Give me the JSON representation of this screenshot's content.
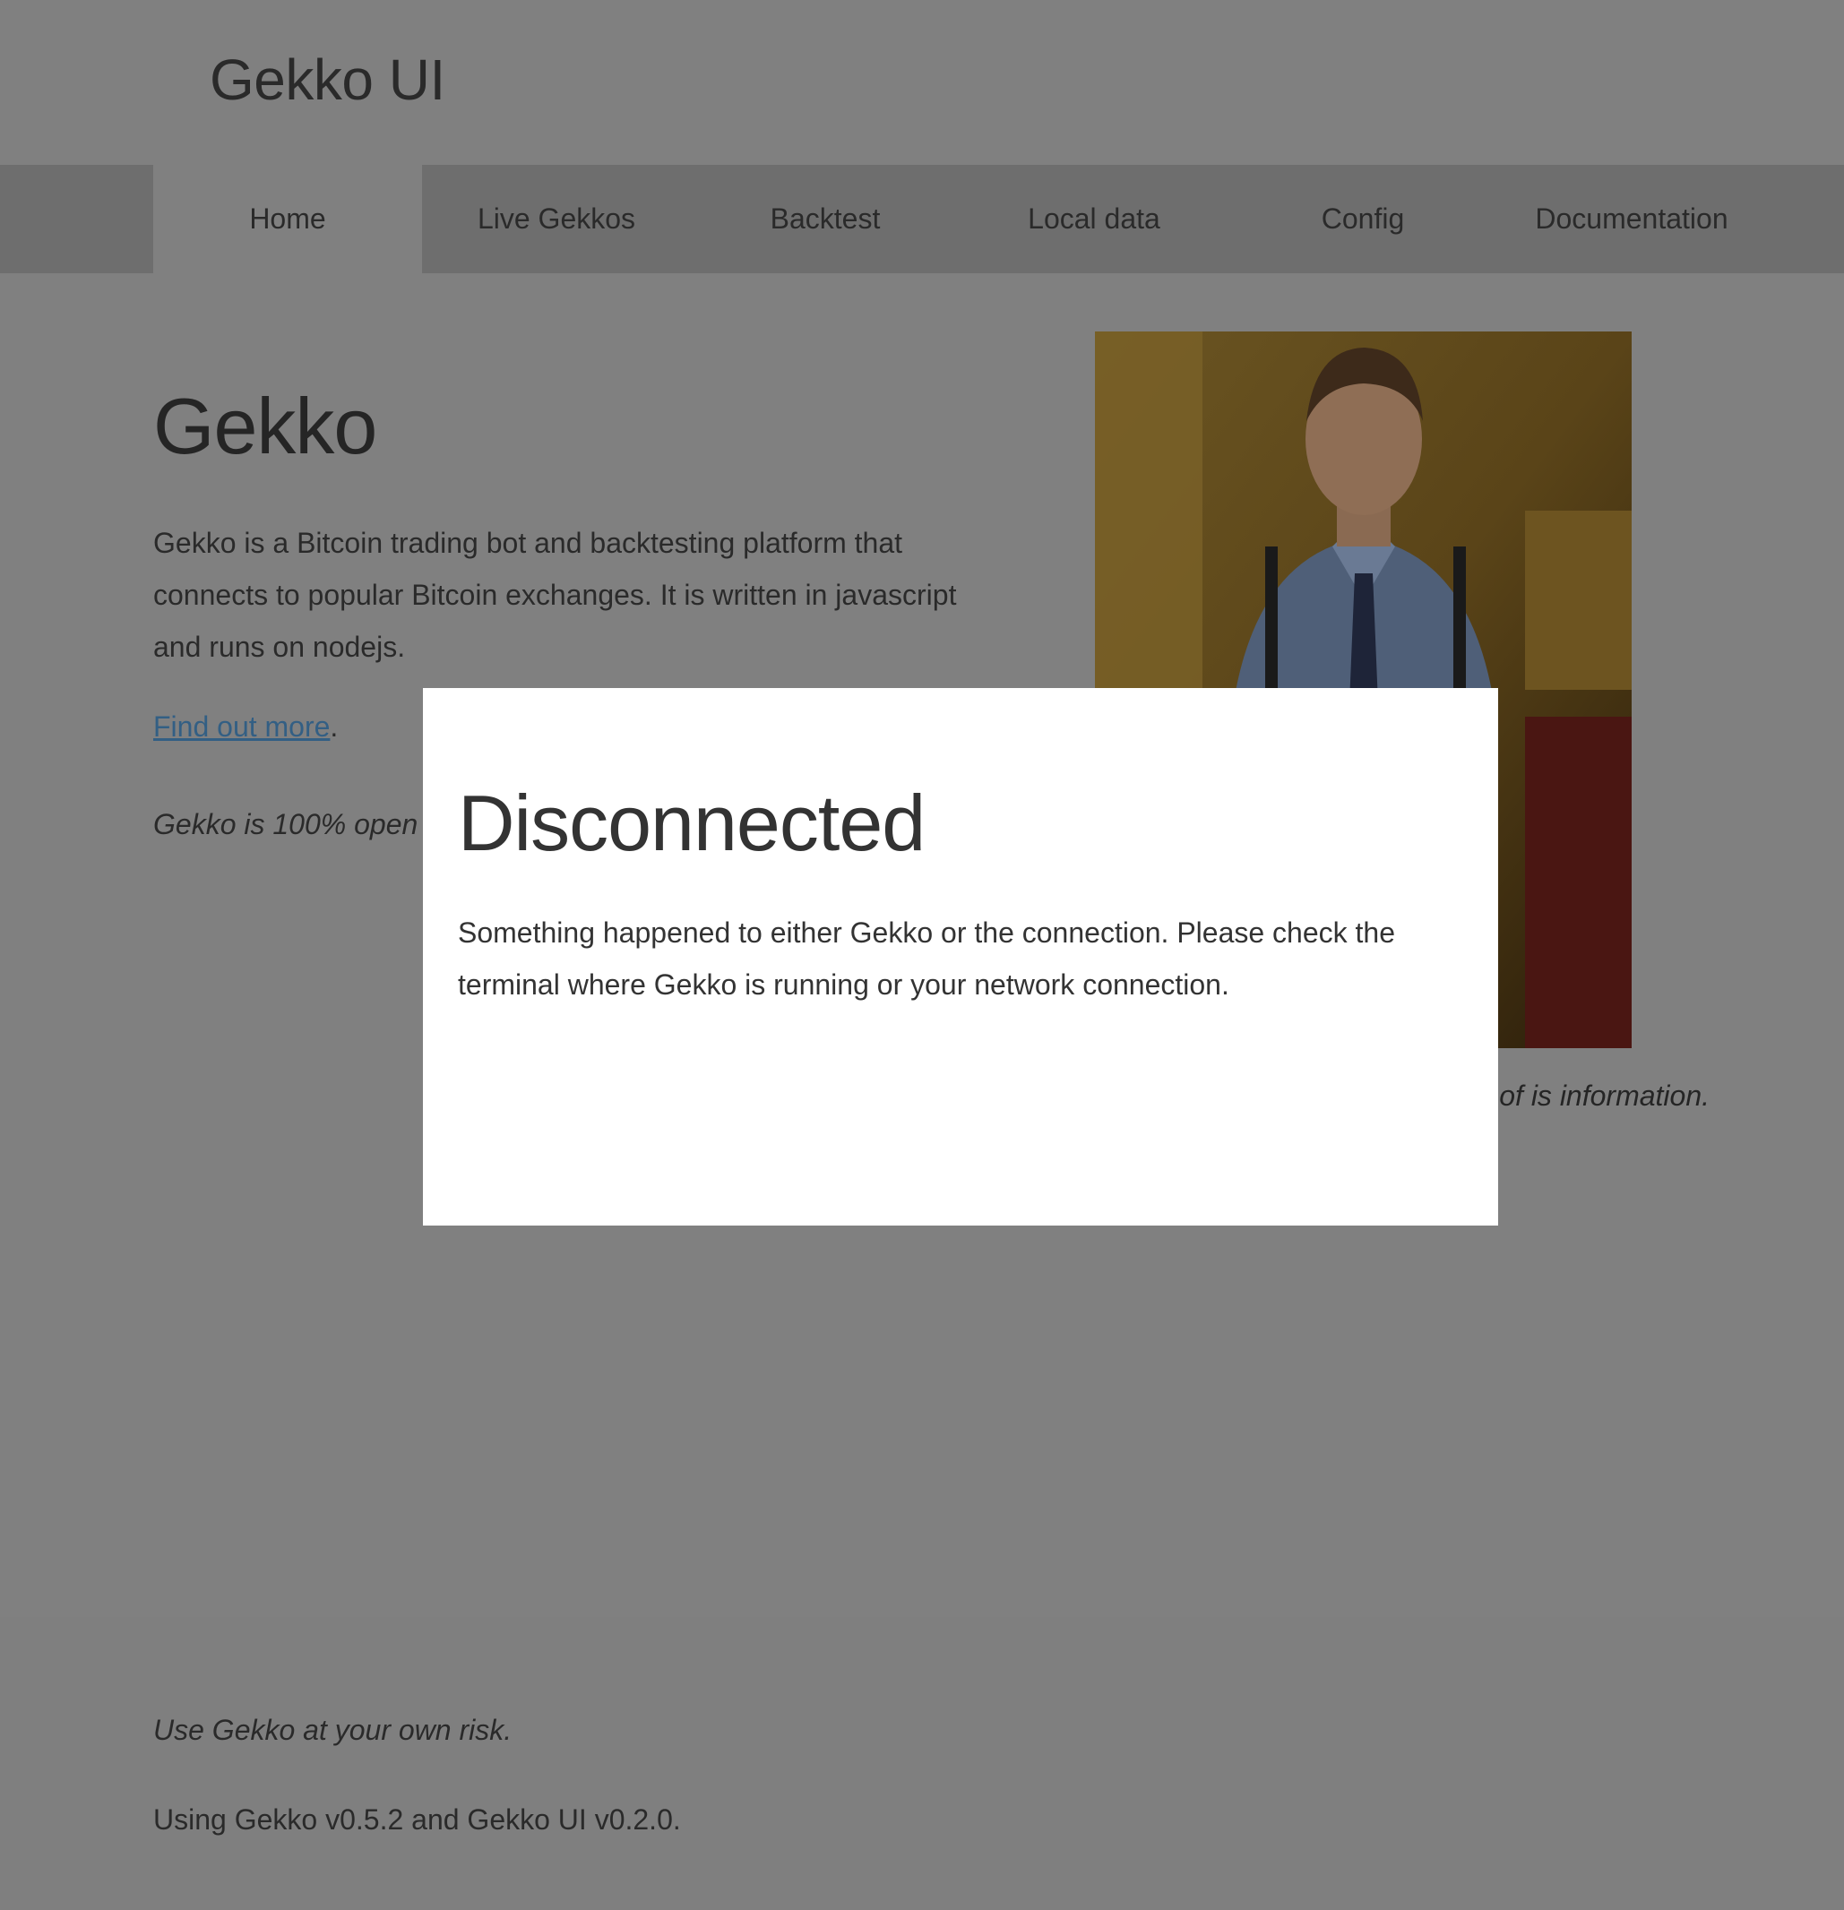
{
  "app": {
    "title": "Gekko UI"
  },
  "nav": {
    "items": [
      {
        "label": "Home"
      },
      {
        "label": "Live Gekkos"
      },
      {
        "label": "Backtest"
      },
      {
        "label": "Local data"
      },
      {
        "label": "Config"
      },
      {
        "label": "Documentation"
      }
    ],
    "active_index": 0
  },
  "home": {
    "title": "Gekko",
    "intro": "Gekko is a Bitcoin trading bot and backtesting platform that connects to popular Bitcoin exchanges. It is written in javascript and runs on nodejs.",
    "find_out_more": "Find out more",
    "find_out_more_suffix": ".",
    "disclaimer": "Gekko is 100% open have been scammed.",
    "quote": "of is information."
  },
  "footer": {
    "risk": "Use Gekko at your own risk.",
    "version": "Using Gekko v0.5.2 and Gekko UI v0.2.0."
  },
  "modal": {
    "title": "Disconnected",
    "body": "Something happened to either Gekko or the connection. Please check the terminal where Gekko is running or your network connection."
  },
  "colors": {
    "overlay_background": "#808080",
    "nav_background": "#6e6e6e",
    "link": "#335f84",
    "modal_background": "#ffffff"
  }
}
